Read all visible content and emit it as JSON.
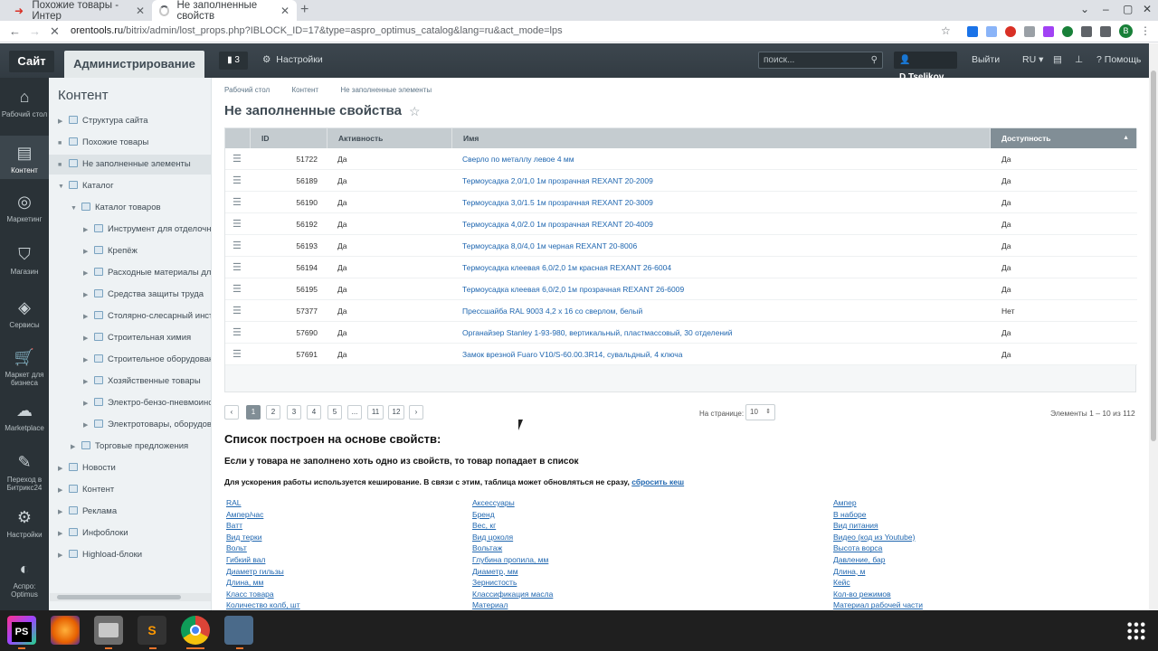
{
  "browser": {
    "tabs": [
      {
        "title": "Похожие товары - Интер",
        "active": false
      },
      {
        "title": "Не заполненные свойств",
        "active": true
      }
    ],
    "url_host": "orentools.ru",
    "url_path": "/bitrix/admin/lost_props.php?IBLOCK_ID=17&type=aspro_optimus_catalog&lang=ru&act_mode=lps",
    "profile_initial": "B"
  },
  "adminbar": {
    "site": "Сайт",
    "admin": "Администрирование",
    "notifications": "3",
    "settings": "Настройки",
    "search_placeholder": "поиск...",
    "user": "D.Tselikov",
    "logout": "Выйти",
    "lang": "RU",
    "help": "Помощь"
  },
  "iconbar": [
    {
      "label": "Рабочий стол",
      "icon": "home-icon"
    },
    {
      "label": "Контент",
      "icon": "content-icon",
      "active": true
    },
    {
      "label": "Маркетинг",
      "icon": "marketing-icon"
    },
    {
      "label": "Магазин",
      "icon": "shop-icon"
    },
    {
      "label": "Сервисы",
      "icon": "services-icon"
    },
    {
      "label": "Маркет для бизнеса",
      "icon": "market-icon"
    },
    {
      "label": "Marketplace",
      "icon": "marketplace-icon"
    },
    {
      "label": "Переход в Битрикс24",
      "icon": "bitrix24-icon"
    },
    {
      "label": "Настройки",
      "icon": "settings-icon"
    },
    {
      "label": "Аспро: Optimus",
      "icon": "aspro-icon"
    }
  ],
  "tree": {
    "title": "Контент",
    "items": [
      "Структура сайта",
      "Похожие товары",
      "Не заполненные элементы",
      "Каталог",
      "Каталог товаров",
      "Инструмент для отделочных",
      "Крепёж",
      "Расходные материалы для э",
      "Средства защиты труда",
      "Столярно-слесарный инстру",
      "Строительная химия",
      "Строительное оборудование",
      "Хозяйственные товары",
      "Электро-бензо-пневмоинстр",
      "Электротовары, оборудован",
      "Торговые предложения",
      "Новости",
      "Контент",
      "Реклама",
      "Инфоблоки",
      "Highload-блоки"
    ]
  },
  "breadcrumb": [
    "Рабочий стол",
    "Контент",
    "Не заполненные элементы"
  ],
  "page_title": "Не заполненные свойства",
  "grid": {
    "headers": {
      "id": "ID",
      "active": "Активность",
      "name": "Имя",
      "avail": "Доступность"
    },
    "rows": [
      {
        "id": "51722",
        "active": "Да",
        "name": "Сверло по металлу левое 4 мм",
        "avail": "Да"
      },
      {
        "id": "56189",
        "active": "Да",
        "name": "Термоусадка 2,0/1,0 1м прозрачная REXANT 20-2009",
        "avail": "Да"
      },
      {
        "id": "56190",
        "active": "Да",
        "name": "Термоусадка 3,0/1.5 1м прозрачная REXANT 20-3009",
        "avail": "Да"
      },
      {
        "id": "56192",
        "active": "Да",
        "name": "Термоусадка 4,0/2.0 1м прозрачная REXANT 20-4009",
        "avail": "Да"
      },
      {
        "id": "56193",
        "active": "Да",
        "name": "Термоусадка 8,0/4,0 1м черная REXANT 20-8006",
        "avail": "Да"
      },
      {
        "id": "56194",
        "active": "Да",
        "name": "Термоусадка клеевая 6,0/2,0 1м красная REXANT 26-6004",
        "avail": "Да"
      },
      {
        "id": "56195",
        "active": "Да",
        "name": "Термоусадка клеевая 6,0/2,0 1м прозрачная REXANT 26-6009",
        "avail": "Да"
      },
      {
        "id": "57377",
        "active": "Да",
        "name": "Прессшайба RAL 9003 4,2 х 16 со сверлом, белый",
        "avail": "Нет"
      },
      {
        "id": "57690",
        "active": "Да",
        "name": "Органайзер Stanley 1-93-980, вертикальный, пластмассовый, 30 отделений",
        "avail": "Да"
      },
      {
        "id": "57691",
        "active": "Да",
        "name": "Замок врезной Fuaro V10/S-60.00.3R14, сувальдный, 4 ключа",
        "avail": "Да"
      }
    ]
  },
  "pager": {
    "prev": "‹",
    "pages": [
      "1",
      "2",
      "3",
      "4",
      "5",
      "...",
      "11",
      "12"
    ],
    "current": "1",
    "next": "›",
    "per_page_label": "На странице:",
    "per_page": "10",
    "count_text": "Элементы 1 – 10 из 112"
  },
  "props": {
    "heading": "Список построен на основе свойств:",
    "note1": "Если у товара не заполнено хоть одно из свойств, то товар попадает в список",
    "note2": "Для ускорения работы используется кеширование. В связи с этим, таблица может обновляться не сразу,",
    "reset_link": "сбросить кеш",
    "col1": [
      "RAL",
      "Ампер/час",
      "Ватт",
      "Вид терки",
      "Вольт",
      "Гибкий вал",
      "Диаметр гильзы",
      "Длина, мм",
      "Класс товара",
      "Количество колб, шт"
    ],
    "col2": [
      "Аксессуары",
      "Бренд",
      "Вес, кг",
      "Вид цоколя",
      "Вольтаж",
      "Глубина пропила, мм",
      "Диаметр, мм",
      "Зернистость",
      "Классификация масла",
      "Материал"
    ],
    "col3": [
      "Ампер",
      "В наборе",
      "Вид питания",
      "Видео (код из Youtube)",
      "Высота ворса",
      "Давление, бар",
      "Длина, м",
      "Кейс",
      "Кол-во режимов",
      "Материал рабочей части"
    ]
  },
  "taskbar": {
    "phpstorm": "PS",
    "sublime": "S"
  }
}
